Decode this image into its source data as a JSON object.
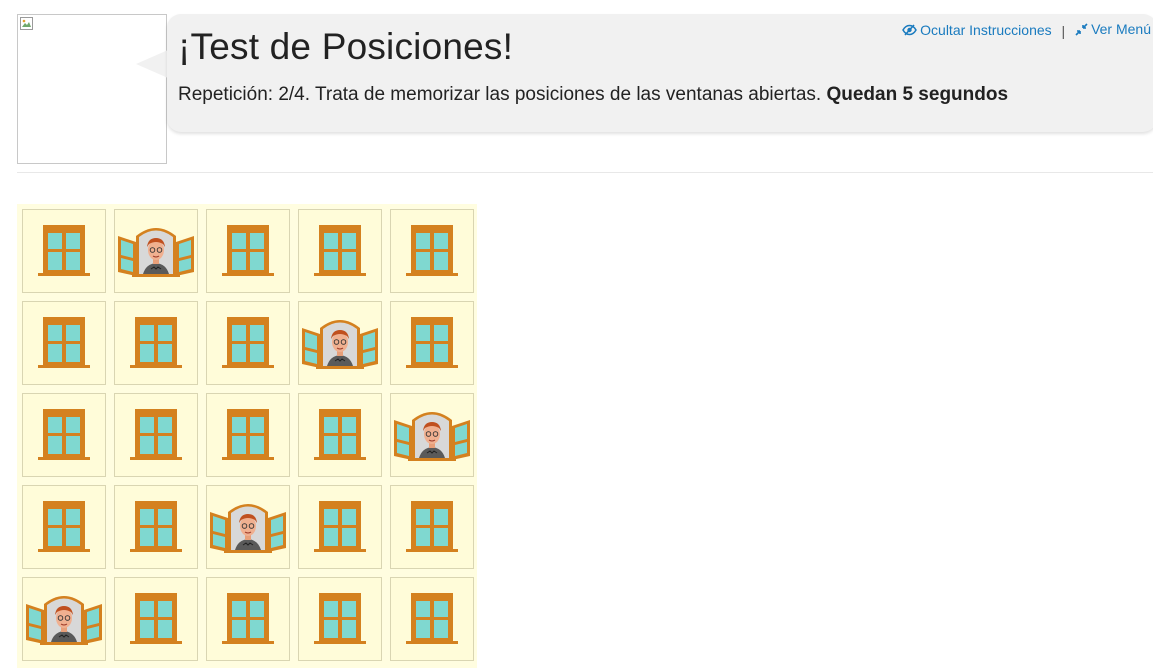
{
  "header": {
    "title": "¡Test de Posiciones!",
    "message_prefix": "Repetición: 2/4. Trata de memorizar las posiciones de las ventanas abiertas. ",
    "message_bold": "Quedan 5 segundos",
    "hide_instructions_label": "Ocultar Instrucciones",
    "separator": "|",
    "menu_label": "Ver Menú"
  },
  "game": {
    "rows": 5,
    "cols": 5,
    "open_windows": [
      [
        0,
        1
      ],
      [
        1,
        3
      ],
      [
        2,
        4
      ],
      [
        3,
        2
      ],
      [
        4,
        0
      ]
    ]
  },
  "colors": {
    "frame": "#d4811f",
    "glass": "#7fd8d0",
    "cell_bg": "#fffcd9",
    "board_bg": "#fffde0",
    "link": "#1a7bbf"
  }
}
